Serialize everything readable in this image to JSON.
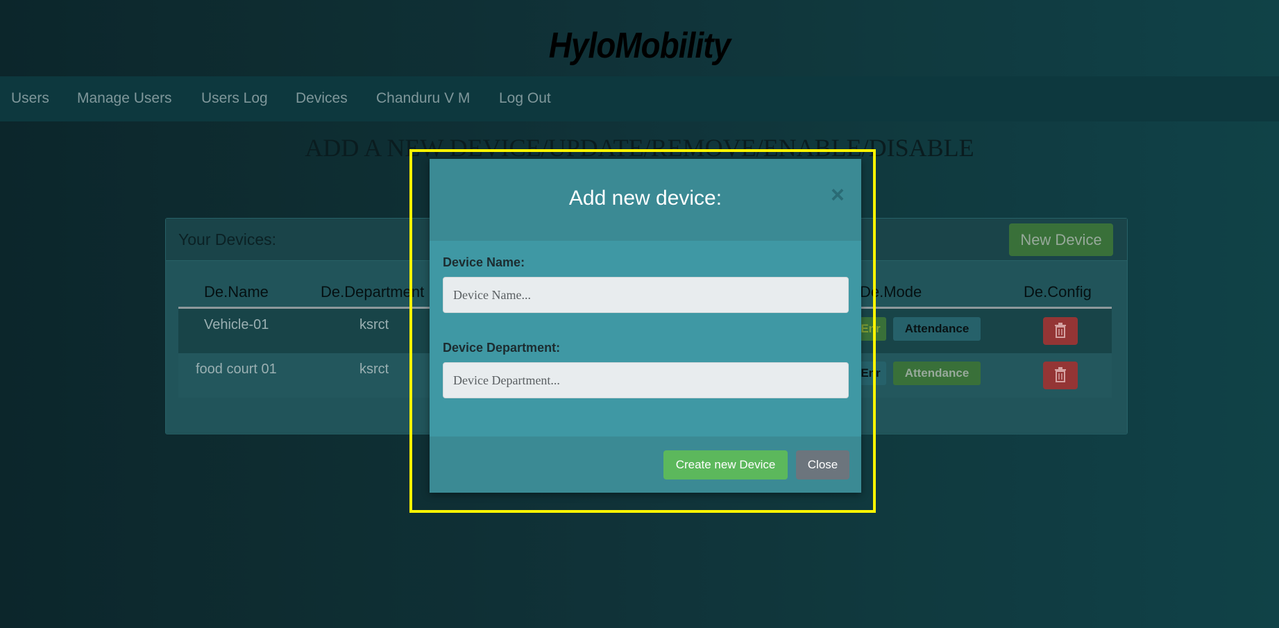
{
  "header": {
    "logo": "HyloMobility"
  },
  "nav": {
    "items": [
      {
        "label": "Users"
      },
      {
        "label": "Manage Users"
      },
      {
        "label": "Users Log"
      },
      {
        "label": "Devices"
      },
      {
        "label": "Chanduru V M"
      },
      {
        "label": "Log Out"
      }
    ]
  },
  "page": {
    "heading": "ADD A NEW DEVICE/UPDATE/REMOVE/ENABLE/DISABLE"
  },
  "devices_panel": {
    "title": "Your Devices:",
    "new_device_label": "New Device",
    "columns": [
      "De.Name",
      "De.Department",
      "De.Mode",
      "De.Config"
    ],
    "rows": [
      {
        "name": "Vehicle-01",
        "department": "ksrct",
        "mode_left": "Enr",
        "mode_right": "Attendance"
      },
      {
        "name": "food court 01",
        "department": "ksrct",
        "mode_left": "Enr",
        "mode_right": "Attendance"
      }
    ],
    "trash_icon": "trash-icon"
  },
  "modal": {
    "title": "Add new device:",
    "close_symbol": "×",
    "device_name": {
      "label": "Device Name:",
      "placeholder": "Device Name...",
      "value": ""
    },
    "device_department": {
      "label": "Device Department:",
      "placeholder": "Device Department...",
      "value": ""
    },
    "create_label": "Create new Device",
    "close_label": "Close"
  },
  "colors": {
    "highlight": "#fff500",
    "success": "#5cb85c",
    "danger": "#a13a3a",
    "modal_body": "#3f98a4"
  }
}
